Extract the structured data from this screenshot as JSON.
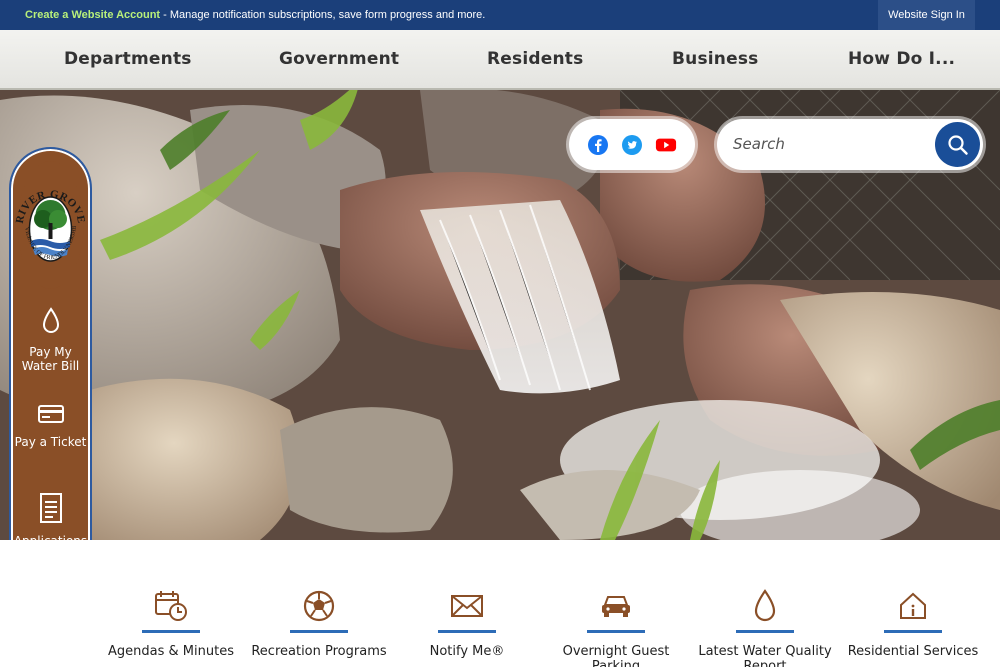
{
  "topbar": {
    "create_link": "Create a Website Account",
    "message": " - Manage notification subscriptions, save form progress and more.",
    "signin": "Website Sign In"
  },
  "nav": {
    "items": [
      "Departments",
      "Government",
      "Residents",
      "Business",
      "How Do I..."
    ]
  },
  "search": {
    "placeholder": "Search"
  },
  "social": [
    "facebook-icon",
    "twitter-icon",
    "youtube-icon"
  ],
  "logo": {
    "top_text": "RIVER GROVE",
    "side_text": "THE VILLAGE OF FRIENDLY NEIGHBORS"
  },
  "rail": {
    "items": [
      {
        "label": "Pay My Water Bill",
        "icon": "water-drop-icon"
      },
      {
        "label": "Pay a Ticket",
        "icon": "credit-card-icon"
      },
      {
        "label": "Applications & Permits",
        "icon": "document-icon"
      }
    ]
  },
  "quicklinks": {
    "items": [
      {
        "label": "Agendas & Minutes",
        "icon": "calendar-clock-icon"
      },
      {
        "label": "Recreation Programs",
        "icon": "soccer-ball-icon"
      },
      {
        "label": "Notify Me®",
        "icon": "envelope-icon"
      },
      {
        "label": "Overnight Guest Parking",
        "icon": "car-icon"
      },
      {
        "label": "Latest Water Quality Report",
        "icon": "water-drop-icon"
      },
      {
        "label": "Residential Services",
        "icon": "house-info-icon"
      }
    ]
  },
  "colors": {
    "topbar": "#1b3f7a",
    "accent_green": "#b8f07a",
    "brown": "#8a4f27",
    "blue": "#1a4e98"
  }
}
